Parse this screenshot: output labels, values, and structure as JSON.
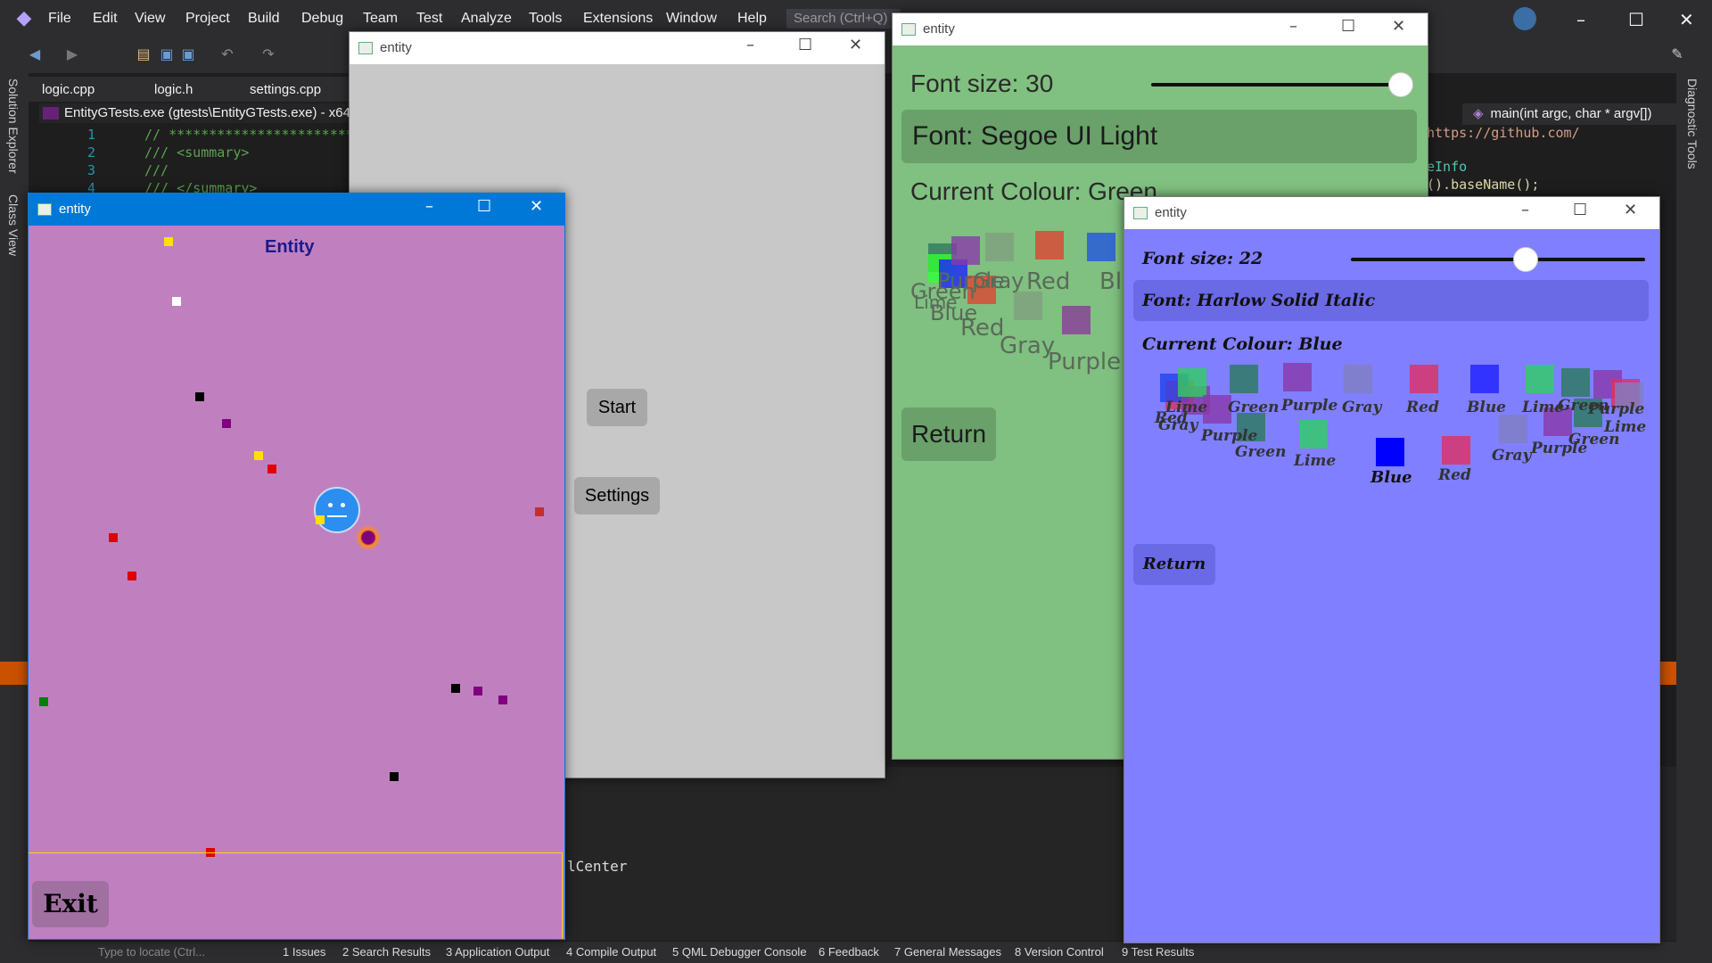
{
  "vs": {
    "menu": [
      "File",
      "Edit",
      "View",
      "Project",
      "Build",
      "Debug",
      "Team",
      "Test",
      "Analyze",
      "Tools",
      "Extensions",
      "Window",
      "Help"
    ],
    "search_placeholder": "Search (Ctrl+Q)",
    "tabs": [
      "logic.cpp",
      "logic.h",
      "settings.cpp"
    ],
    "path": "EntityGTests.exe (gtests\\EntityGTests.exe) - x64-D",
    "left_rail": [
      "Solution Explorer",
      "Class View"
    ],
    "right_rail": "Diagnostic Tools",
    "code_lines": [
      {
        "num": "1",
        "text": "// ************************************"
      },
      {
        "num": "2",
        "text": "/// <summary>"
      },
      {
        "num": "3",
        "text": "///"
      },
      {
        "num": "4",
        "text": "/// </summary>"
      }
    ],
    "func_bar": "main(int argc, char * argv[])",
    "right_code": [
      "https://github.com/",
      "eInfo",
      "().baseName();"
    ],
    "code_fragment": "lCenter",
    "status_items": [
      "Type to locate (Ctrl...",
      "1 Issues",
      "2 Search Results",
      "3 Application Output",
      "4 Compile Output",
      "5 QML Debugger Console",
      "6 Feedback",
      "7 General Messages",
      "8 Version Control",
      "9 Test Results"
    ]
  },
  "windows": {
    "menu_window": {
      "title": "entity",
      "start_label": "Start",
      "settings_label": "Settings"
    },
    "game_window": {
      "title": "entity",
      "heading": "Entity",
      "exit_label": "Exit",
      "bg_color": "#c080c0"
    },
    "green_settings": {
      "title": "entity",
      "font_size_label": "Font size: 30",
      "font_label": "Font: Segoe UI Light",
      "colour_label": "Current Colour: Green",
      "return_label": "Return",
      "bg_color": "#80c080",
      "slider_level": 1.0,
      "swatch_labels": [
        "Green",
        "Gray",
        "Red",
        "Blue",
        "Lime",
        "Purple",
        "Red",
        "Gray",
        "Purple",
        "Blue"
      ]
    },
    "blue_settings": {
      "title": "entity",
      "font_size_label": "Font size: 22",
      "font_label": "Font: Harlow Solid Italic",
      "colour_label": "Current Colour: Blue",
      "return_label": "Return",
      "bg_color": "#7f7fff",
      "slider_level": 0.6,
      "swatch_labels": [
        "Lime",
        "Green",
        "Purple",
        "Gray",
        "Red",
        "Blue",
        "Lime",
        "Green",
        "Purple",
        "Gray",
        "Red",
        "Purple",
        "Green",
        "Lime",
        "Blue",
        "Red",
        "Gray",
        "Purple",
        "Green",
        "Lime"
      ]
    }
  }
}
